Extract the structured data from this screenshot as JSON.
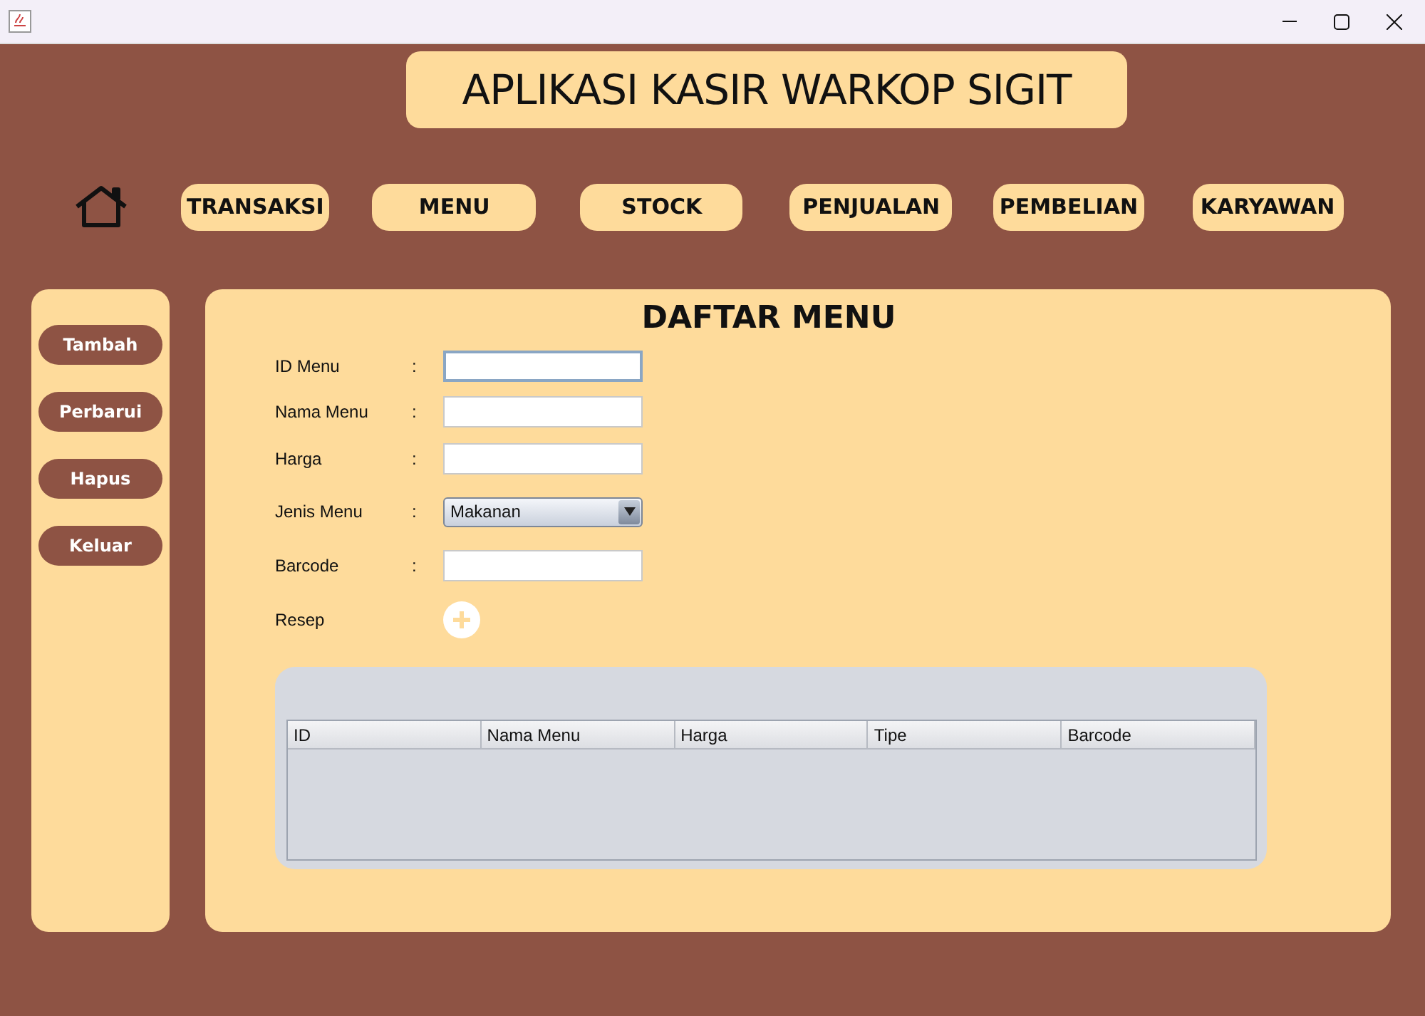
{
  "app_title": "APLIKASI KASIR WARKOP SIGIT",
  "nav": [
    {
      "label": "TRANSAKSI"
    },
    {
      "label": "MENU"
    },
    {
      "label": "STOCK"
    },
    {
      "label": "PENJUALAN"
    },
    {
      "label": "PEMBELIAN"
    },
    {
      "label": "KARYAWAN"
    }
  ],
  "sidebar": [
    {
      "label": "Tambah"
    },
    {
      "label": "Perbarui"
    },
    {
      "label": "Hapus"
    },
    {
      "label": "Keluar"
    }
  ],
  "panel_title": "DAFTAR MENU",
  "form": [
    {
      "label": "ID Menu",
      "kind": "text",
      "focused": true
    },
    {
      "label": "Nama Menu",
      "kind": "text",
      "focused": false
    },
    {
      "label": "Harga",
      "kind": "text",
      "focused": false
    },
    {
      "label": "Jenis Menu",
      "kind": "select",
      "value": "Makanan"
    },
    {
      "label": "Barcode",
      "kind": "text",
      "focused": false
    },
    {
      "label": "Resep",
      "kind": "add"
    }
  ],
  "separator": ":",
  "table": {
    "columns": [
      "ID",
      "Nama Menu",
      "Harga",
      "Tipe",
      "Barcode"
    ]
  }
}
